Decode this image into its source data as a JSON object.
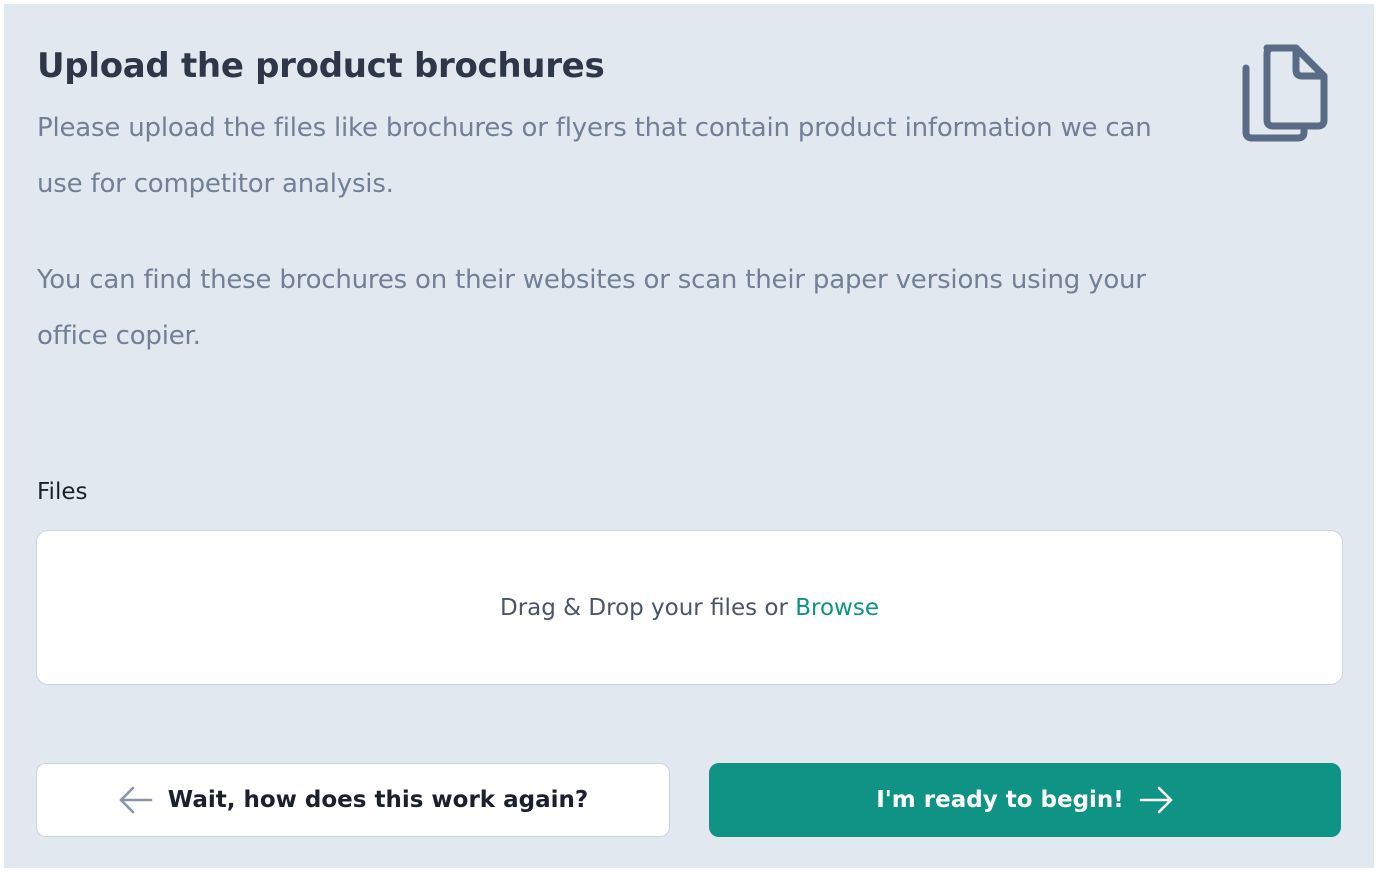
{
  "header": {
    "title": "Upload the product brochures",
    "description_1": "Please upload the files like brochures or flyers that contain product information we can use for competitor analysis.",
    "description_2": "You can find these brochures on their websites or scan their paper versions using your office copier.",
    "icon": "document-copy-icon"
  },
  "upload": {
    "label": "Files",
    "drop_text": "Drag & Drop your files or",
    "browse_label": "Browse"
  },
  "actions": {
    "back_label": "Wait, how does this work again?",
    "back_icon": "arrow-left-icon",
    "start_label": "I'm ready to begin!",
    "start_icon": "arrow-right-icon"
  },
  "colors": {
    "panel_background": "#e2e8f0",
    "heading": "#2d3748",
    "body_text": "#718096",
    "accent": "#0e9384",
    "border": "#cbd5e0"
  }
}
